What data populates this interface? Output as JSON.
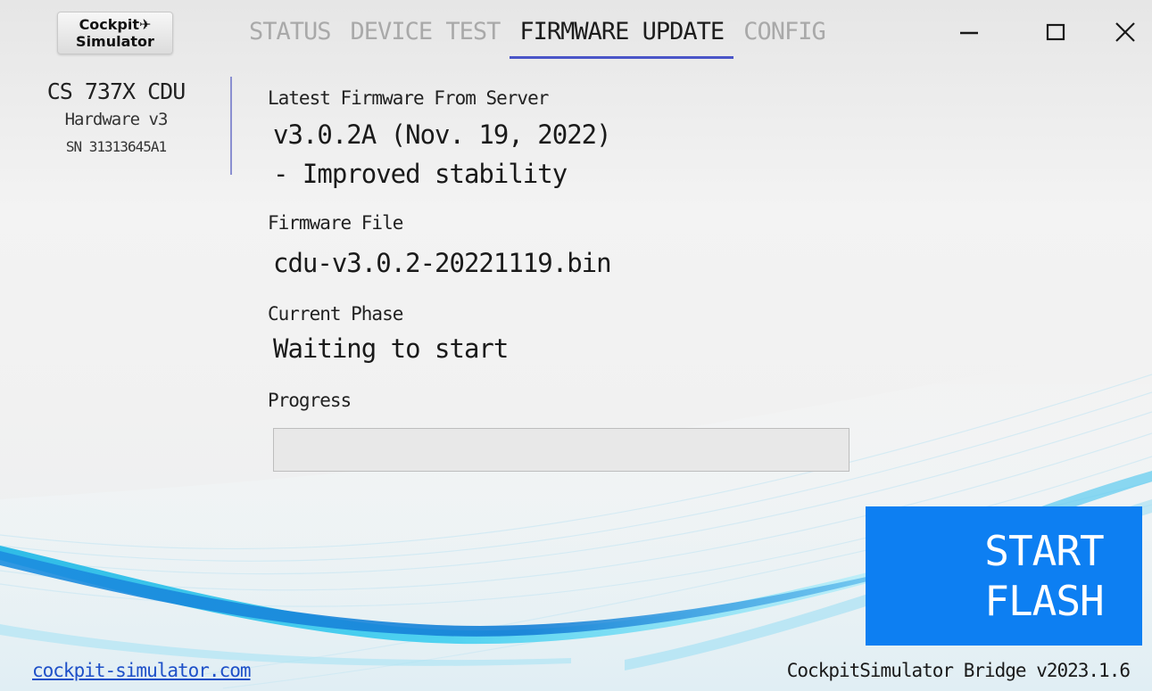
{
  "logo": {
    "line1": "Cockpit✈",
    "line2": "Simulator"
  },
  "tabs": [
    {
      "label": "STATUS",
      "active": false
    },
    {
      "label": "DEVICE TEST",
      "active": false
    },
    {
      "label": "FIRMWARE UPDATE",
      "active": true
    },
    {
      "label": "CONFIG",
      "active": false
    }
  ],
  "window_controls": {
    "minimize_icon": "minimize-icon",
    "maximize_icon": "maximize-icon",
    "close_icon": "close-icon"
  },
  "device": {
    "model": "CS 737X CDU",
    "hardware": "Hardware v3",
    "serial": "SN 31313645A1"
  },
  "firmware": {
    "latest_label": "Latest Firmware From Server",
    "latest_version": "v3.0.2A (Nov. 19, 2022)",
    "latest_notes": "- Improved stability",
    "file_label": "Firmware File",
    "file_value": "cdu-v3.0.2-20221119.bin",
    "phase_label": "Current Phase",
    "phase_value": "Waiting to start",
    "progress_label": "Progress",
    "progress_percent": 0
  },
  "start_button": {
    "line1": "START",
    "line2": "FLASH"
  },
  "footer": {
    "link": "cockpit-simulator.com",
    "version": "CockpitSimulator Bridge v2023.1.6"
  },
  "colors": {
    "accent": "#0d7ff2",
    "tab_underline": "#4a55c8",
    "divider": "#8a8fd0",
    "wave_cyan": "#2ec3e8",
    "wave_blue": "#1872d8"
  }
}
